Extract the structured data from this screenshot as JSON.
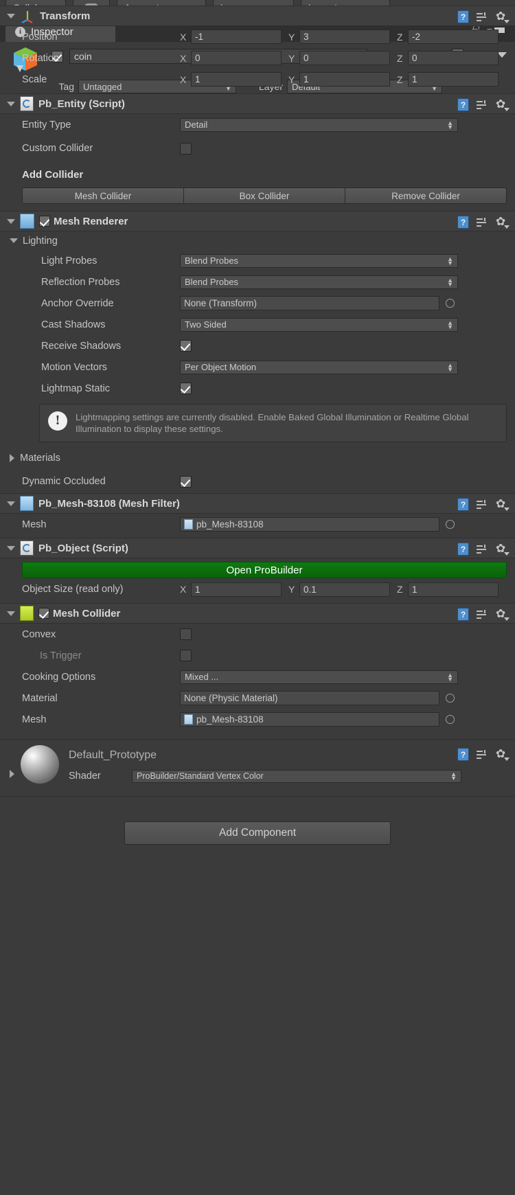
{
  "toolbar": {
    "collab_label": "Collab",
    "cloud_icon": "cloud-icon",
    "account_label": "Account",
    "layers_label": "Layers",
    "layout_label": "Layout"
  },
  "tab": {
    "label": "Inspector",
    "info_glyph": "i",
    "lock_icon": "lock-icon",
    "menu_icon": "hamburger-menu-icon"
  },
  "object_header": {
    "enabled": true,
    "name": "coin",
    "static_label": "Static",
    "static_checked": true,
    "tag_label": "Tag",
    "tag_value": "Untagged",
    "layer_label": "Layer",
    "layer_value": "Default"
  },
  "transform": {
    "title": "Transform",
    "rows": [
      {
        "label": "Position",
        "x": "-1",
        "y": "3",
        "z": "-2"
      },
      {
        "label": "Rotation",
        "x": "0",
        "y": "0",
        "z": "0"
      },
      {
        "label": "Scale",
        "x": "1",
        "y": "1",
        "z": "1"
      }
    ],
    "axis_x": "X",
    "axis_y": "Y",
    "axis_z": "Z"
  },
  "pb_entity": {
    "title": "Pb_Entity (Script)",
    "entity_type_label": "Entity Type",
    "entity_type_value": "Detail",
    "custom_collider_label": "Custom Collider",
    "custom_collider_checked": false,
    "add_collider_label": "Add Collider",
    "buttons": [
      "Mesh Collider",
      "Box Collider",
      "Remove Collider"
    ]
  },
  "mesh_renderer": {
    "title": "Mesh Renderer",
    "enabled": true,
    "lighting_label": "Lighting",
    "light_probes_label": "Light Probes",
    "light_probes_value": "Blend Probes",
    "reflection_probes_label": "Reflection Probes",
    "reflection_probes_value": "Blend Probes",
    "anchor_override_label": "Anchor Override",
    "anchor_override_value": "None (Transform)",
    "cast_shadows_label": "Cast Shadows",
    "cast_shadows_value": "Two Sided",
    "receive_shadows_label": "Receive Shadows",
    "receive_shadows_checked": true,
    "motion_vectors_label": "Motion Vectors",
    "motion_vectors_value": "Per Object Motion",
    "lightmap_static_label": "Lightmap Static",
    "lightmap_static_checked": true,
    "info_message": "Lightmapping settings are currently disabled. Enable Baked Global Illumination or Realtime Global Illumination to display these settings.",
    "materials_label": "Materials",
    "dynamic_occluded_label": "Dynamic Occluded",
    "dynamic_occluded_checked": true
  },
  "mesh_filter": {
    "title": "Pb_Mesh-83108 (Mesh Filter)",
    "mesh_label": "Mesh",
    "mesh_value": "pb_Mesh-83108"
  },
  "pb_object": {
    "title": "Pb_Object (Script)",
    "open_probuilder_label": "Open ProBuilder",
    "object_size_label": "Object Size (read only)",
    "size_x": "1",
    "size_y": "0.1",
    "size_z": "1",
    "axis_x": "X",
    "axis_y": "Y",
    "axis_z": "Z"
  },
  "mesh_collider": {
    "title": "Mesh Collider",
    "enabled": true,
    "convex_label": "Convex",
    "convex_checked": false,
    "is_trigger_label": "Is Trigger",
    "is_trigger_checked": false,
    "cooking_options_label": "Cooking Options",
    "cooking_options_value": "Mixed ...",
    "material_label": "Material",
    "material_value": "None (Physic Material)",
    "mesh_label": "Mesh",
    "mesh_value": "pb_Mesh-83108"
  },
  "material_preview": {
    "title": "Default_Prototype",
    "shader_label": "Shader",
    "shader_value": "ProBuilder/Standard Vertex Color"
  },
  "footer": {
    "add_component_label": "Add Component"
  },
  "colors": {
    "panel_bg": "#3b3b3b",
    "header_bg": "#3f3f3f",
    "accent_green": "#0f7a11",
    "field_bg": "#464646",
    "text": "#c5c5c5"
  }
}
